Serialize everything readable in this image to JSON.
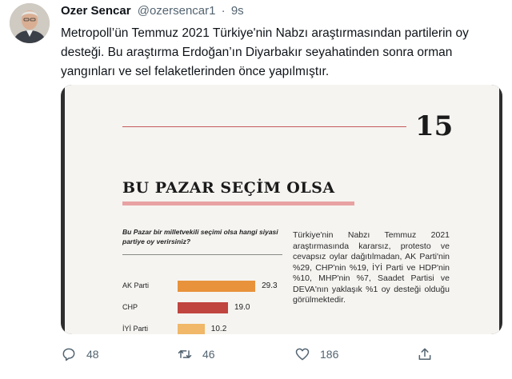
{
  "author": {
    "name": "Ozer Sencar",
    "handle": "@ozersencar1",
    "separator": "·",
    "time": "9s"
  },
  "tweet": {
    "text": "Metropoll’ün Temmuz 2021 Türkiye'nin Nabzı araştırmasından partilerin oy desteği. Bu araştırma Erdoğan’ın Diyarbakır seyahatinden sonra orman yangınları ve sel felaketlerinden önce yapılmıştır."
  },
  "image": {
    "page_number": "15",
    "heading": "BU PAZAR SEÇİM OLSA",
    "question": "Bu Pazar bir milletvekili seçimi olsa hangi siyasi partiye oy verirsiniz?",
    "summary": "Türkiye'nin Nabzı Temmuz 2021 araştırmasında kararsız, protesto ve cevapsız oylar dağıtılmadan, AK Parti'nin %29, CHP'nin %19, İYİ Parti ve HDP'nin %10, MHP'nin %7, Saadet Partisi ve DEVA'nın yaklaşık %1 oy desteği olduğu görülmektedir."
  },
  "chart_data": {
    "type": "bar",
    "orientation": "horizontal",
    "categories": [
      "AK Parti",
      "CHP",
      "İYİ Parti"
    ],
    "values": [
      29.3,
      19.0,
      10.2
    ],
    "value_labels": [
      "29.3",
      "19.0",
      "10.2"
    ],
    "colors": [
      "#e8923c",
      "#c0443f",
      "#f0b868"
    ],
    "xlim": [
      0,
      35
    ]
  },
  "actions": {
    "reply_count": "48",
    "retweet_count": "46",
    "like_count": "186"
  },
  "icons": [
    "reply-icon",
    "retweet-icon",
    "like-icon",
    "share-icon"
  ],
  "colors": {
    "text": "#0f1419",
    "secondary": "#536471"
  }
}
